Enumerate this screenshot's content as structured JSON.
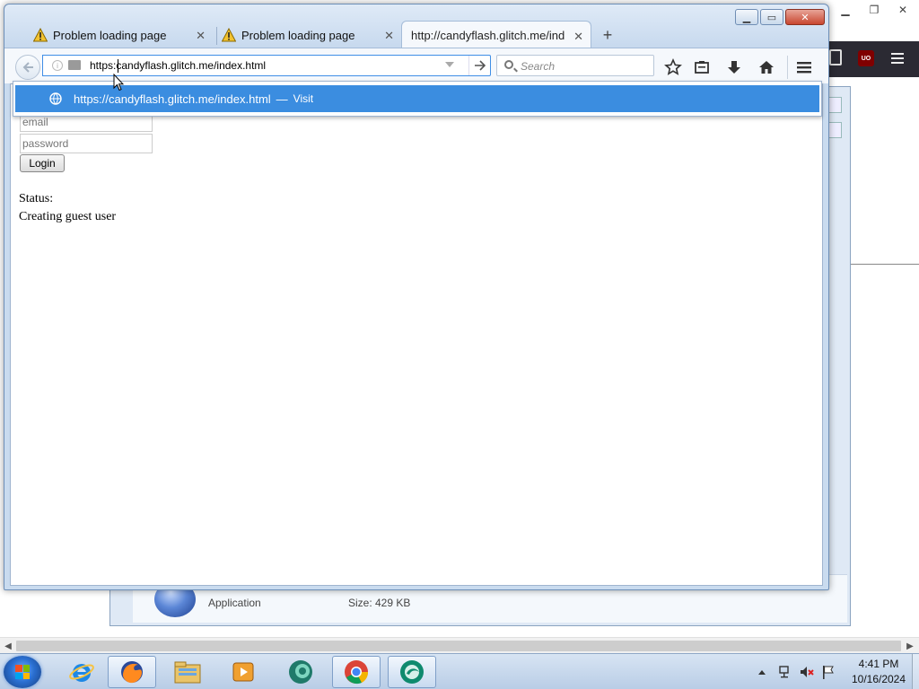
{
  "browser": {
    "tabs": [
      {
        "label": "Problem loading page",
        "icon": "warning-icon",
        "active": false
      },
      {
        "label": "Problem loading page",
        "icon": "warning-icon",
        "active": false
      },
      {
        "label": "http://candyflash.glitch.me/ind",
        "icon": "",
        "active": true
      }
    ],
    "new_tab_label": "+",
    "url_value": "https:candyflash.glitch.me/index.html",
    "search_placeholder": "Search",
    "suggestion": {
      "url": "https://candyflash.glitch.me/index.html",
      "separator": "—",
      "action": "Visit"
    }
  },
  "page": {
    "email_placeholder": "email",
    "password_placeholder": "password",
    "login_label": "Login",
    "status_label": "Status:",
    "status_value": "Creating guest user"
  },
  "background_window": {
    "file_type": "Application",
    "file_size": "Size: 429 KB"
  },
  "taskbar": {
    "time": "4:41 PM",
    "date": "10/16/2024",
    "items": [
      "internet-explorer-icon",
      "firefox-icon",
      "file-explorer-icon",
      "media-player-icon",
      "chromium-browser-icon",
      "chrome-icon",
      "browser-app-icon"
    ]
  },
  "colors": {
    "accent": "#3b8de0",
    "taskbar": "#c6d8ee",
    "ublock": "#800000"
  }
}
